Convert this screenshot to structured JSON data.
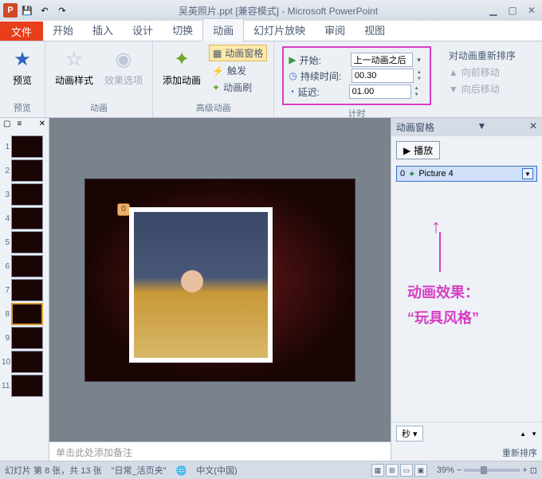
{
  "title": "吴英照片.ppt [兼容模式] - Microsoft PowerPoint",
  "tabs": {
    "file": "文件",
    "home": "开始",
    "insert": "插入",
    "design": "设计",
    "transitions": "切换",
    "animations": "动画",
    "slideshow": "幻灯片放映",
    "review": "审阅",
    "view": "视图"
  },
  "ribbon": {
    "preview": {
      "btn": "预览",
      "label": "预览"
    },
    "anim": {
      "styles": "动画样式",
      "options": "效果选项",
      "label": "动画"
    },
    "advanced": {
      "add": "添加动画",
      "pane": "动画窗格",
      "trigger": "触发",
      "painter": "动画刷",
      "label": "高级动画"
    },
    "timing": {
      "start_lbl": "开始:",
      "start_val": "上一动画之后",
      "duration_lbl": "持续时间:",
      "duration_val": "00.30",
      "delay_lbl": "延迟:",
      "delay_val": "01.00",
      "label": "计时"
    },
    "reorder": {
      "label": "对动画重新排序",
      "fwd": "向前移动",
      "back": "向后移动"
    }
  },
  "thumbs": {
    "count": 11,
    "selected": 8
  },
  "slide": {
    "badge": "0"
  },
  "notes": "单击此处添加备注",
  "pane": {
    "title": "动画窗格",
    "play": "播放",
    "item_num": "0",
    "item_name": "Picture 4",
    "effect_label": "动画效果：",
    "effect_name": "“玩具风格”",
    "sec": "秒",
    "reorder": "重新排序"
  },
  "status": {
    "slide": "幻灯片 第 8 张，共 13 张",
    "theme": "\"日常_活页夹\"",
    "lang": "中文(中国)",
    "zoom": "39%"
  }
}
